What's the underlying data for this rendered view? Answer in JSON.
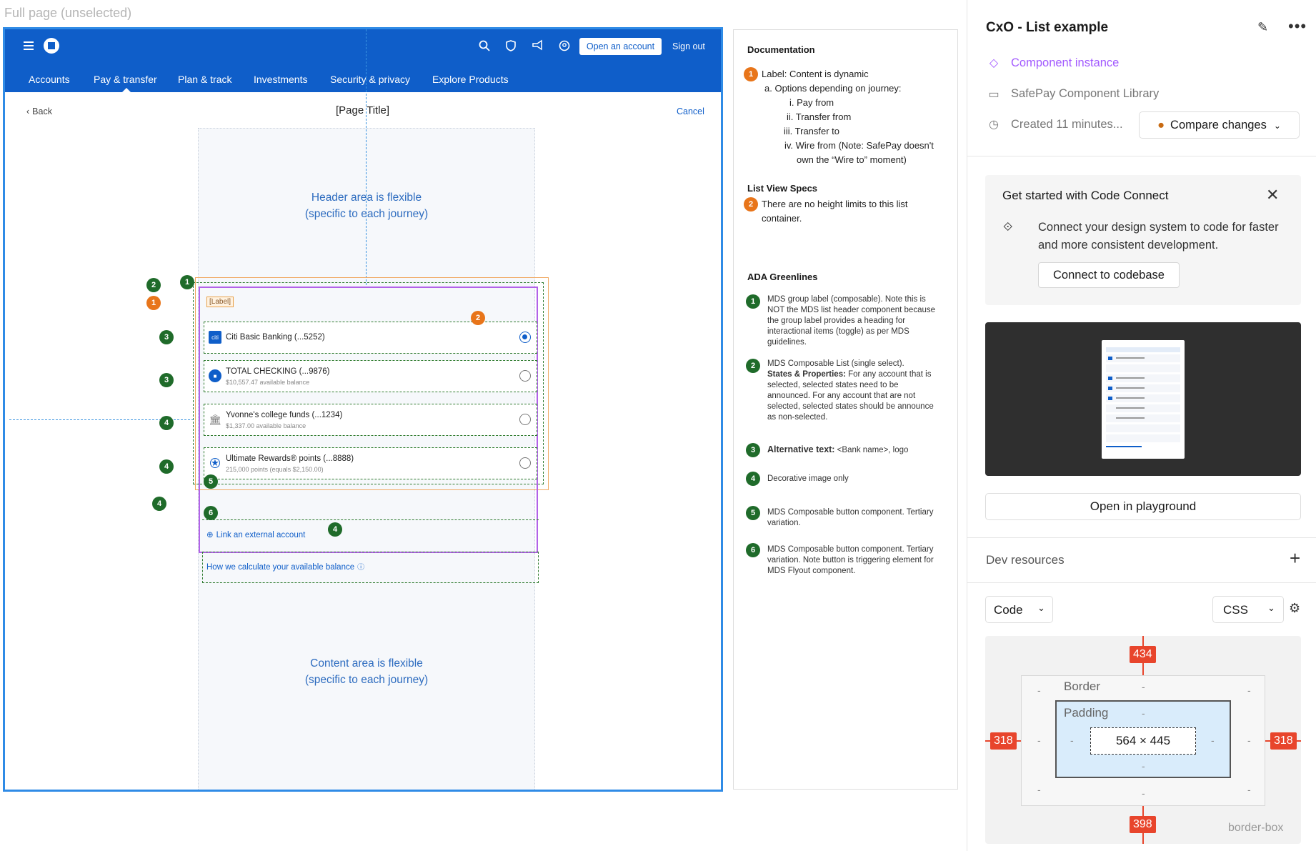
{
  "canvas": {
    "frame_label": "Full page (unselected)"
  },
  "app": {
    "topbar": {
      "open_account": "Open an account",
      "sign_out": "Sign out",
      "icons": [
        "menu-icon",
        "bank-logo-icon",
        "search-icon",
        "shield-icon",
        "megaphone-icon",
        "profile-icon"
      ]
    },
    "nav": [
      "Accounts",
      "Pay & transfer",
      "Plan & track",
      "Investments",
      "Security & privacy",
      "Explore Products"
    ],
    "back": "Back",
    "page_title": "[Page Title]",
    "cancel": "Cancel",
    "header_note": [
      "Header area is flexible",
      "(specific to each journey)"
    ],
    "content_note": [
      "Content area is flexible",
      "(specific to each journey)"
    ],
    "group_label": "[Label]",
    "accounts": [
      {
        "name": "Citi Basic Banking (...5252)",
        "sub": "",
        "icon": "citi-logo-icon",
        "selected": true
      },
      {
        "name": "TOTAL CHECKING (...9876)",
        "sub": "$10,557.47 available balance",
        "icon": "bank-logo-icon",
        "selected": false
      },
      {
        "name": "Yvonne's college funds (...1234)",
        "sub": "$1,337.00 available balance",
        "icon": "bank-building-icon",
        "selected": false
      },
      {
        "name": "Ultimate Rewards® points (...8888)",
        "sub": "215,000 points (equals $2,150.00)",
        "icon": "rewards-icon",
        "selected": false
      }
    ],
    "link_external": "Link an external account",
    "calc_link": "How we calculate your available balance"
  },
  "badges": {
    "g1": "1",
    "g2": "2",
    "g3": "3",
    "g4": "4",
    "g5": "5",
    "g6": "6",
    "o1": "1",
    "o2": "2"
  },
  "doc": {
    "title": "Documentation",
    "label_line": "Label: Content is dynamic",
    "options_line": "a. Options depending on journey:",
    "options": [
      "i. Pay from",
      "ii. Transfer from",
      "iii. Transfer to",
      "iv. Wire from (Note: SafePay doesn't",
      "own the “Wire to” moment)"
    ],
    "list_title": "List View Specs",
    "list_text": "There are no height limits to this list",
    "list_text2": "container.",
    "ada_title": "ADA Greenlines",
    "ada": [
      {
        "n": "1",
        "text": "MDS group label (composable). Note this is NOT the MDS list header component because the group label provides a heading for interactional items (toggle) as per MDS guidelines."
      },
      {
        "n": "2",
        "text": "MDS Composable List (single select).",
        "bold": "States & Properties:",
        "rest": " For any account that is selected, selected states need to be announced. For any account that are not selected, selected states should be announce as non-selected."
      },
      {
        "n": "3",
        "bold": "Alternative text:",
        "rest": " <Bank name>, logo"
      },
      {
        "n": "4",
        "text": "Decorative image only"
      },
      {
        "n": "5",
        "text": "MDS Composable button component. Tertiary variation."
      },
      {
        "n": "6",
        "text": "MDS Composable button component. Tertiary variation. Note button is triggering element for MDS Flyout component."
      }
    ]
  },
  "panel": {
    "title": "CxO - List example",
    "component_instance": "Component instance",
    "library": "SafePay Component Library",
    "created": "Created 11 minutes...",
    "compare": "Compare changes",
    "code_connect_title": "Get started with Code Connect",
    "code_connect_body": "Connect your design system to code for faster and more consistent development.",
    "connect_btn": "Connect to codebase",
    "playground_btn": "Open in playground",
    "dev_resources": "Dev resources",
    "code_dd": "Code",
    "css_dd": "CSS",
    "box": {
      "margin_top": "434",
      "margin_bottom": "398",
      "margin_left": "318",
      "margin_right": "318",
      "border": "Border",
      "padding": "Padding",
      "content": "564 × 445",
      "mode": "border-box",
      "dash": "-"
    },
    "accent": "#a259ff",
    "tag_color": "#e8452c"
  }
}
